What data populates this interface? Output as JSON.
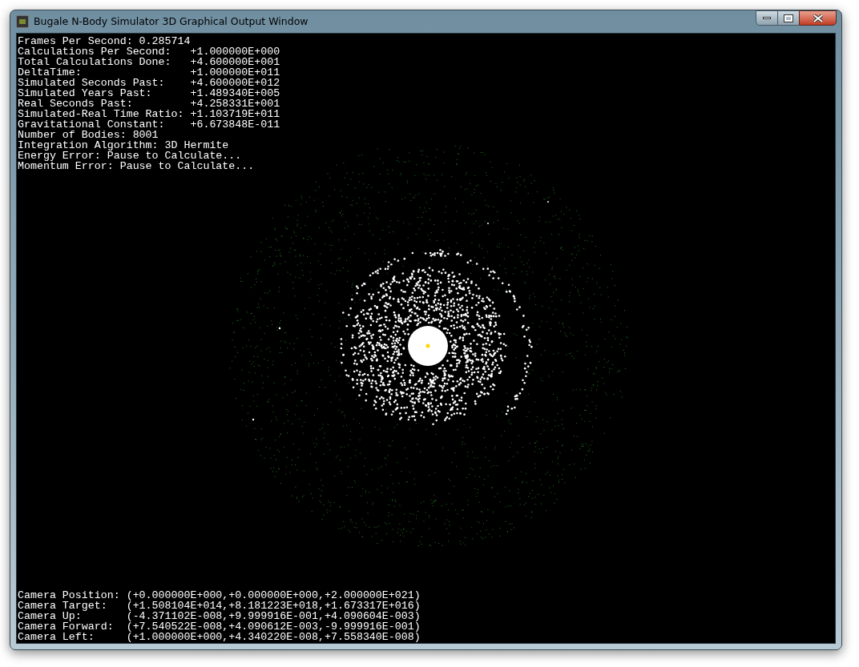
{
  "window": {
    "title": "Bugale N-Body Simulator 3D Graphical Output Window"
  },
  "stats": [
    "Frames Per Second: 0.285714",
    "Calculations Per Second:   +1.000000E+000",
    "Total Calculations Done:   +4.600000E+001",
    "DeltaTime:                 +1.000000E+011",
    "Simulated Seconds Past:    +4.600000E+012",
    "Simulated Years Past:      +1.489340E+005",
    "Real Seconds Past:         +4.258331E+001",
    "Simulated-Real Time Ratio: +1.103719E+011",
    "Gravitational Constant:    +6.673848E-011",
    "Number of Bodies: 8001",
    "Integration Algorithm: 3D Hermite",
    "Energy Error: Pause to Calculate...",
    "Momentum Error: Pause to Calculate..."
  ],
  "camera": [
    "Camera Position: (+0.000000E+000,+0.000000E+000,+2.000000E+021)",
    "Camera Target:   (+1.508104E+014,+8.181223E+018,+1.673317E+016)",
    "Camera Up:       (-4.371102E-008,+9.999916E-001,+4.090604E-003)",
    "Camera Forward:  (+7.540522E-008,+4.090612E-003,-9.999916E-001)",
    "Camera Left:     (+1.000000E+000,+4.340220E-008,+7.558340E-008)"
  ]
}
